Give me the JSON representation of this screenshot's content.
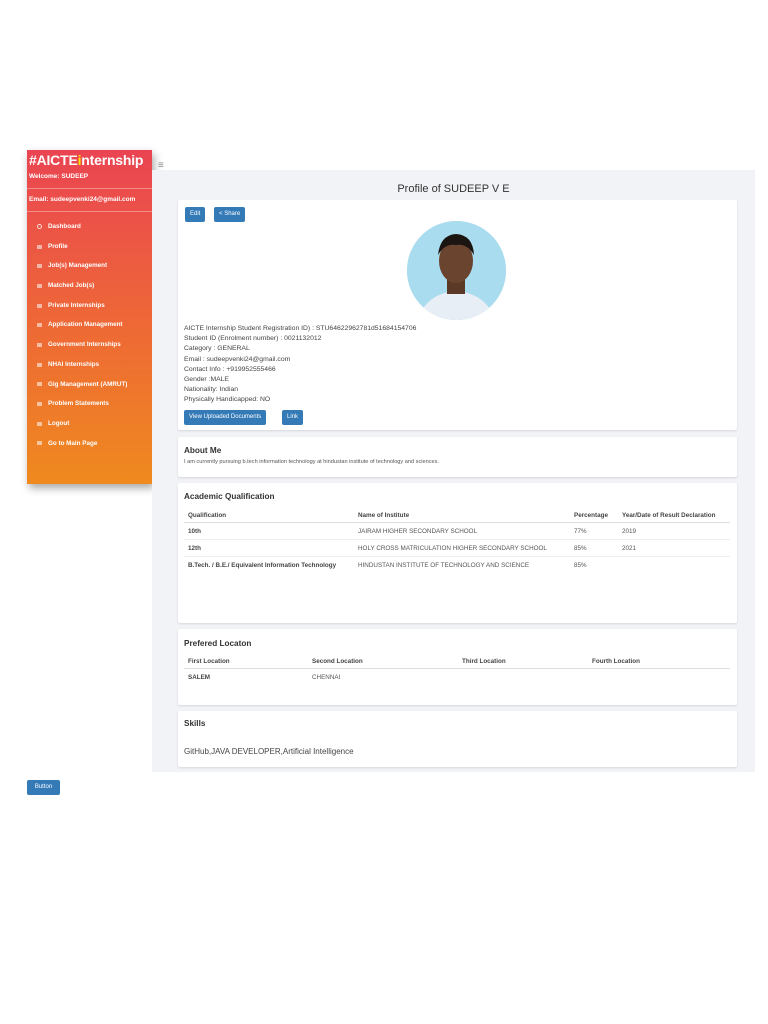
{
  "sidebar": {
    "brand_prefix": "#AICTE",
    "brand_i": "i",
    "brand_suffix": "nternship",
    "welcome": "Welcome: SUDEEP",
    "email": "Email: sudeepvenki24@gmail.com",
    "items": [
      {
        "label": "Dashboard"
      },
      {
        "label": "Profile"
      },
      {
        "label": "Job(s) Management"
      },
      {
        "label": "Matched Job(s)"
      },
      {
        "label": "Private Internships"
      },
      {
        "label": "Application Management"
      },
      {
        "label": "Government Internships"
      },
      {
        "label": "NHAI Internships"
      },
      {
        "label": "Gig Management (AMRUT)"
      },
      {
        "label": "Problem Statements"
      },
      {
        "label": "Logout"
      },
      {
        "label": "Go to Main Page"
      }
    ]
  },
  "header": {
    "menu_icon": "≡",
    "title": "Profile of SUDEEP V E"
  },
  "profile": {
    "edit": "Edit",
    "share": "Share",
    "info": [
      "AICTE Internship Student Registration ID) : STU64622962781d51684154706",
      "Student ID (Enrolment number) : 0021132012",
      "Category : GENERAL",
      "Email : sudeepvenki24@gmail.com",
      "Contact Info : +919952555466",
      "Gender :MALE",
      "Nationality: Indian",
      "Physically Handicapped: NO"
    ],
    "view_docs": "View Uploaded Documents",
    "link": "Link"
  },
  "about": {
    "title": "About Me",
    "text": "I am currently pursuing b.tech information technology at hindustan institute of technology and sciences."
  },
  "academic": {
    "title": "Academic Qualification",
    "headers": [
      "Qualification",
      "Name of Institute",
      "Percentage",
      "Year/Date of Result Declaration"
    ],
    "rows": [
      [
        "10th",
        "JAIRAM HIGHER SECONDARY SCHOOL",
        "77%",
        "2019"
      ],
      [
        "12th",
        "HOLY CROSS MATRICULATION HIGHER SECONDARY SCHOOL",
        "85%",
        "2021"
      ],
      [
        "B.Tech. / B.E./ Equivalent Information Technology",
        "HINDUSTAN INSTITUTE OF TECHNOLOGY AND SCIENCE",
        "85%",
        ""
      ]
    ]
  },
  "location": {
    "title": "Prefered Locaton",
    "headers": [
      "First Location",
      "Second Location",
      "Third Location",
      "Fourth Location"
    ],
    "row": [
      "SALEM",
      "CHENNAI",
      "",
      ""
    ]
  },
  "skills": {
    "title": "Skills",
    "text": "GitHub,JAVA DEVELOPER,Artificial Intelligence"
  },
  "footer": {
    "button": "Button"
  }
}
